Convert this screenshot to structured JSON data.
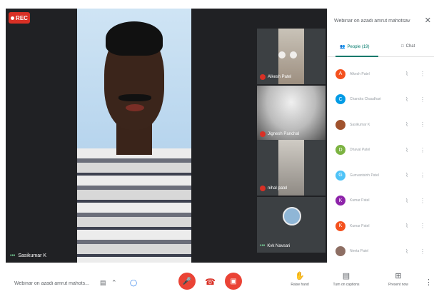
{
  "stage": {
    "rec_label": "REC",
    "main_speaker": "Sasikumar K",
    "tiles": [
      {
        "name": "Alkesh Patel"
      },
      {
        "name": "Jignesh Panchal"
      },
      {
        "name": "nihal patel"
      },
      {
        "name": "Kvk Navsari"
      }
    ]
  },
  "panel": {
    "title": "Webinar on azadi amrut mahotsav",
    "close_icon": "close-icon",
    "tabs": {
      "people": "People (19)",
      "chat": "Chat"
    },
    "participants": [
      {
        "initial": "A",
        "color": "#f4511e",
        "name": "Alkesh Patel"
      },
      {
        "initial": "C",
        "color": "#039be5",
        "name": "Chandra Chaudhari"
      },
      {
        "initial": "",
        "color": "#a0522d",
        "name": "Sasikumar K"
      },
      {
        "initial": "D",
        "color": "#7cb342",
        "name": "Dhaval Patel"
      },
      {
        "initial": "G",
        "color": "#4fc3f7",
        "name": "Gunvantsinh Patel"
      },
      {
        "initial": "K",
        "color": "#8e24aa",
        "name": "Kumar Patel"
      },
      {
        "initial": "K",
        "color": "#f4511e",
        "name": "Kumar Patel"
      },
      {
        "initial": "",
        "color": "#8d6e63",
        "name": "Neeta Patel"
      }
    ]
  },
  "bottom": {
    "meeting_title": "Webinar on azadi amrut mahots...",
    "raise_hand": "Raise hand",
    "captions": "Turn on captions",
    "present": "Present now"
  }
}
